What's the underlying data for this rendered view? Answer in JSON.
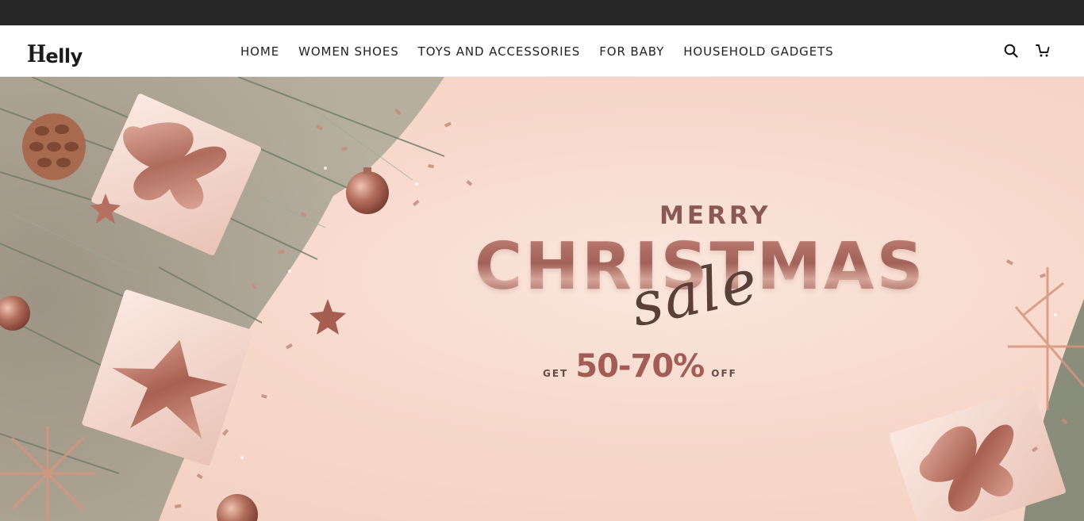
{
  "brand": {
    "logo_mark": "H",
    "logo_text": "elly"
  },
  "nav": {
    "items": [
      {
        "label": "HOME"
      },
      {
        "label": "WOMEN SHOES"
      },
      {
        "label": "TOYS AND ACCESSORIES"
      },
      {
        "label": "FOR BABY"
      },
      {
        "label": "HOUSEHOLD GADGETS"
      }
    ]
  },
  "header_icons": {
    "search": "search-icon",
    "cart": "cart-icon"
  },
  "hero": {
    "merry": "MERRY",
    "christmas": "CHRISTMAS",
    "sale": "sale",
    "offer_prefix": "GET",
    "offer_value": "50-70%",
    "offer_suffix": "OFF"
  },
  "colors": {
    "topbar": "#262626",
    "hero_bg": "#f7d9cc",
    "accent": "#a15d56",
    "pine": "#6d7868",
    "rose_gold": "#c48c7c"
  }
}
